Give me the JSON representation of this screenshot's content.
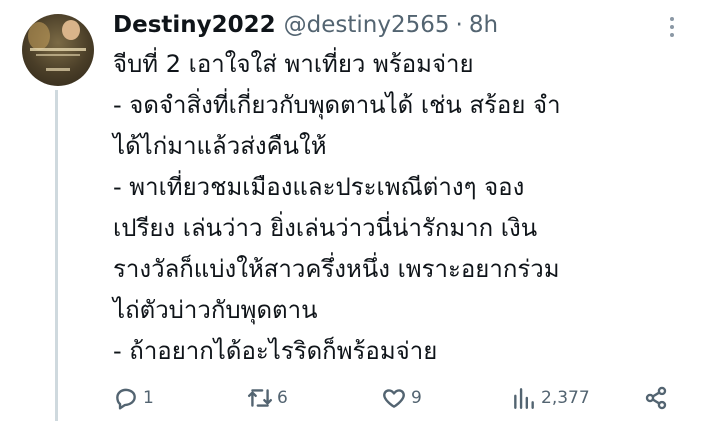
{
  "tweet": {
    "display_name": "Destiny2022",
    "handle": "@destiny2565",
    "separator": "·",
    "time": "8h",
    "lines": [
      "จีบที่ 2 เอาใจใส่ พาเที่ยว พร้อมจ่าย",
      "- จดจำสิ่งที่เกี่ยวกับพุดตานได้ เช่น สร้อย จำ",
      "ได้ไก่มาแล้วส่งคืนให้",
      "- พาเที่ยวชมเมืองและประเพณีต่างๆ จอง",
      "เปรียง เล่นว่าว ยิ่งเล่นว่าวนี่น่ารักมาก เงิน",
      "รางวัลก็แบ่งให้สาวครึ่งหนึ่ง เพราะอยากร่วม",
      "ไถ่ตัวบ่าวกับพุดตาน",
      "- ถ้าอยากได้อะไรริดก็พร้อมจ่าย"
    ]
  },
  "actions": {
    "replies": "1",
    "retweets": "6",
    "likes": "9",
    "views": "2,377"
  },
  "icons": {
    "reply": "reply-icon",
    "retweet": "retweet-icon",
    "like": "heart-icon",
    "views": "views-chart-icon",
    "share": "share-icon",
    "more": "more-options-icon"
  },
  "colors": {
    "text": "#0f1419",
    "secondary": "#536471",
    "thread_line": "#cfd9de"
  }
}
